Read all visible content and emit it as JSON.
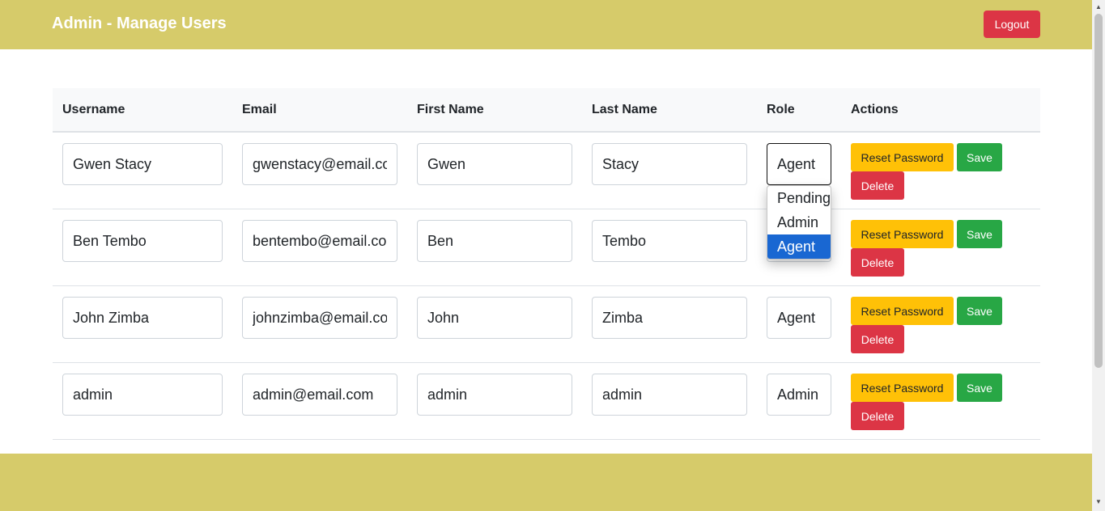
{
  "header": {
    "title": "Admin - Manage Users",
    "logout_label": "Logout"
  },
  "table": {
    "columns": [
      "Username",
      "Email",
      "First Name",
      "Last Name",
      "Role",
      "Actions"
    ],
    "rows": [
      {
        "username": "Gwen Stacy",
        "email": "gwenstacy@email.com",
        "first_name": "Gwen",
        "last_name": "Stacy",
        "role": "Agent"
      },
      {
        "username": "Ben Tembo",
        "email": "bentembo@email.com",
        "first_name": "Ben",
        "last_name": "Tembo",
        "role": "Agent"
      },
      {
        "username": "John Zimba",
        "email": "johnzimba@email.com",
        "first_name": "John",
        "last_name": "Zimba",
        "role": "Agent"
      },
      {
        "username": "admin",
        "email": "admin@email.com",
        "first_name": "admin",
        "last_name": "admin",
        "role": "Admin"
      }
    ]
  },
  "actions": {
    "reset_label": "Reset Password",
    "save_label": "Save",
    "delete_label": "Delete"
  },
  "role_dropdown": {
    "options": [
      "Pending",
      "Admin",
      "Agent"
    ],
    "selected": "Agent"
  },
  "colors": {
    "header": "#d6cb6a",
    "danger": "#dc3545",
    "warning": "#ffc107",
    "success": "#28a745",
    "selection": "#1967d2"
  }
}
